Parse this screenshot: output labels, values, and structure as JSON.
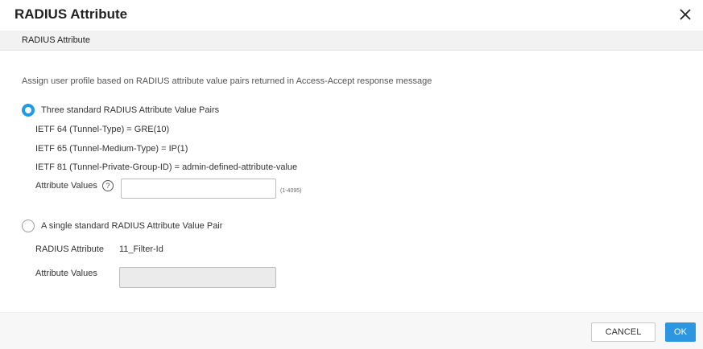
{
  "dialog": {
    "title": "RADIUS Attribute",
    "close_icon": "close-icon"
  },
  "section": {
    "header": "RADIUS Attribute"
  },
  "description": "Assign user profile based on RADIUS attribute value pairs returned in Access-Accept response message",
  "option1": {
    "label": "Three standard RADIUS Attribute Value Pairs",
    "selected": true,
    "lines": [
      "IETF 64 (Tunnel-Type) = GRE(10)",
      "IETF 65 (Tunnel-Medium-Type) = IP(1)",
      "IETF 81 (Tunnel-Private-Group-ID) = admin-defined-attribute-value"
    ],
    "attribute_values_label": "Attribute Values",
    "attribute_values_value": "",
    "range_hint": "(1-4095)",
    "help_icon": "help-circle-icon"
  },
  "option2": {
    "label": "A single standard RADIUS Attribute Value Pair",
    "selected": false,
    "radius_attribute_label": "RADIUS Attribute",
    "radius_attribute_value": "11_Filter-Id",
    "attribute_values_label": "Attribute Values",
    "attribute_values_value": ""
  },
  "footer": {
    "cancel_label": "CANCEL",
    "ok_label": "OK"
  },
  "colors": {
    "accent": "#1a9ce8",
    "ok_button": "#2c97e0"
  }
}
